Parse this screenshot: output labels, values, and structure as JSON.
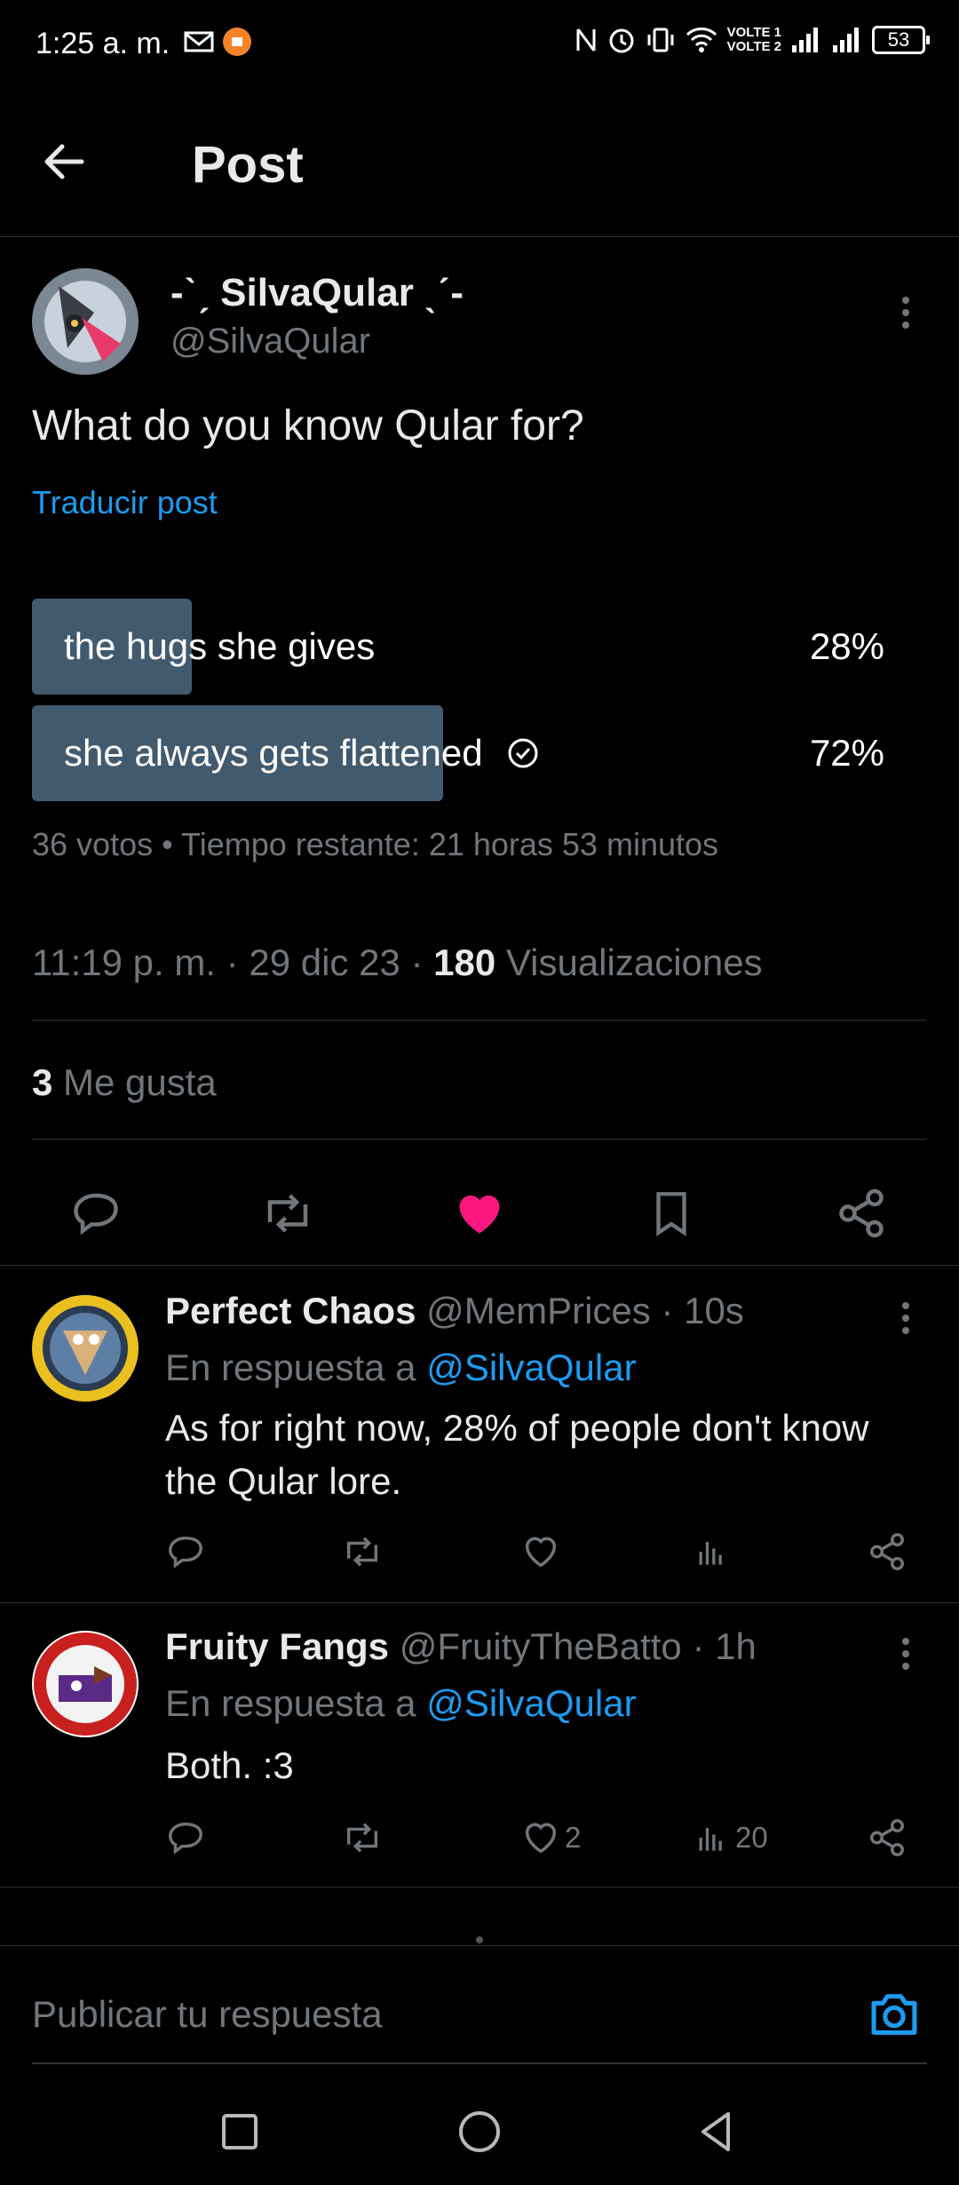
{
  "status_bar": {
    "time": "1:25 a. m.",
    "volte1": "VOLTE 1",
    "volte2": "VOLTE 2",
    "battery": "53"
  },
  "header": {
    "title": "Post"
  },
  "post": {
    "author_name": "-ˋˏ SilvaQular ˎˊ-",
    "author_handle": "@SilvaQular",
    "text": "What do you know Qular for?",
    "translate_label": "Traducir post",
    "poll": {
      "options": [
        {
          "label": "the hugs she gives",
          "percent_label": "28%",
          "percent": 28,
          "selected": false
        },
        {
          "label": "she always gets flattened",
          "percent_label": "72%",
          "percent": 72,
          "selected": true
        }
      ],
      "meta": "36 votos • Tiempo restante: 21 horas 53 minutos"
    },
    "timestamp": "11:19 p. m. · 29 dic 23 · ",
    "views_count": "180",
    "views_label": " Visualizaciones",
    "likes_count": "3",
    "likes_label": " Me gusta"
  },
  "replies": [
    {
      "name": "Perfect Chaos",
      "handle_time": " @MemPrices · 10s",
      "reply_prefix": "En respuesta a ",
      "reply_to": "@SilvaQular",
      "text": "As for right now, 28% of people don't know the Qular lore.",
      "likes": "",
      "views": ""
    },
    {
      "name": "Fruity Fangs",
      "handle_time": " @FruityTheBatto · 1h",
      "reply_prefix": "En respuesta a ",
      "reply_to": "@SilvaQular",
      "text": "Both. :3",
      "likes": "2",
      "views": "20"
    }
  ],
  "composer": {
    "placeholder": "Publicar tu respuesta"
  },
  "colors": {
    "accent": "#1d9bf0",
    "like": "#f91880",
    "poll_bar": "#425a6e",
    "background": "#000000"
  }
}
